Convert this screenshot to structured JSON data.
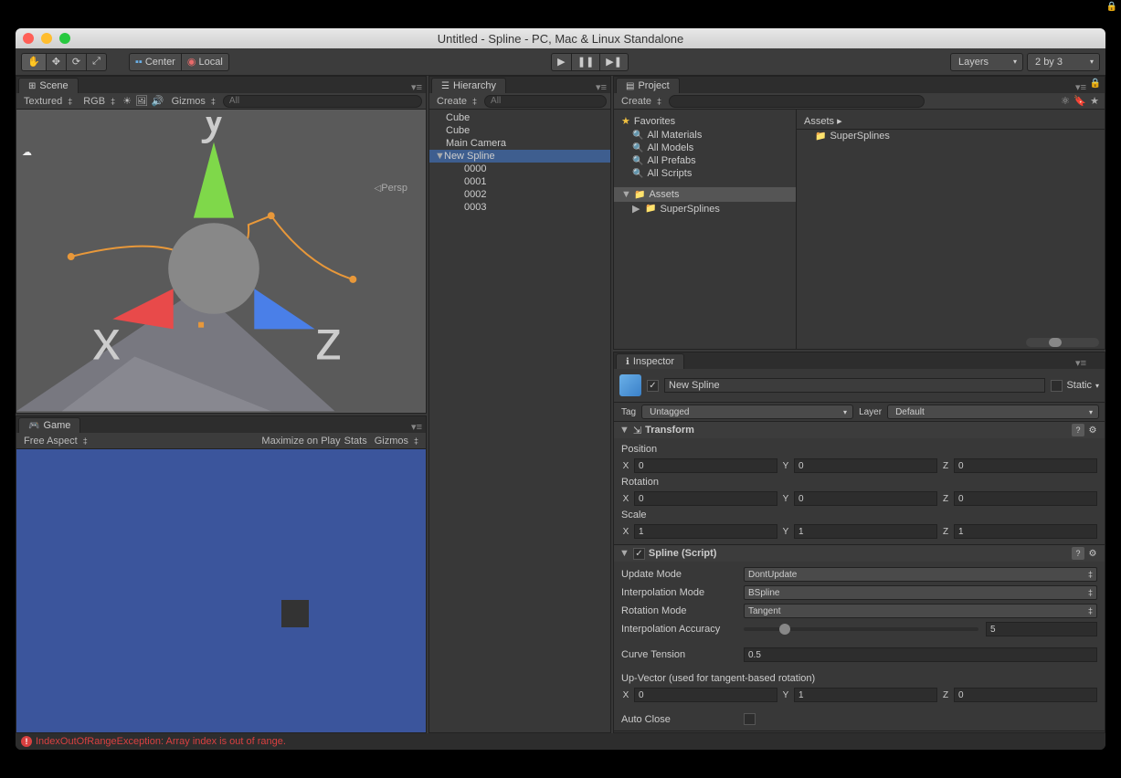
{
  "window": {
    "title": "Untitled - Spline - PC, Mac & Linux Standalone"
  },
  "toolbar": {
    "center": "Center",
    "local": "Local",
    "layers": "Layers",
    "layout": "2 by 3"
  },
  "scene": {
    "tab": "Scene",
    "shading": "Textured",
    "rgb": "RGB",
    "gizmos": "Gizmos",
    "search_placeholder": "All",
    "persp": "Persp",
    "axes": {
      "x": "x",
      "y": "y",
      "z": "z"
    }
  },
  "game": {
    "tab": "Game",
    "aspect": "Free Aspect",
    "maximize": "Maximize on Play",
    "stats": "Stats",
    "gizmos": "Gizmos"
  },
  "hierarchy": {
    "tab": "Hierarchy",
    "create": "Create",
    "search_placeholder": "All",
    "items": [
      "Cube",
      "Cube",
      "Main Camera",
      "New Spline",
      "0000",
      "0001",
      "0002",
      "0003"
    ]
  },
  "project": {
    "tab": "Project",
    "create": "Create",
    "favorites": "Favorites",
    "fav_items": [
      "All Materials",
      "All Models",
      "All Prefabs",
      "All Scripts"
    ],
    "assets": "Assets",
    "asset_items": [
      "SuperSplines"
    ],
    "breadcrumb": "Assets ▸",
    "right_items": [
      "SuperSplines"
    ]
  },
  "inspector": {
    "tab": "Inspector",
    "name": "New Spline",
    "static": "Static",
    "tag_label": "Tag",
    "tag_value": "Untagged",
    "layer_label": "Layer",
    "layer_value": "Default",
    "transform": {
      "title": "Transform",
      "position": "Position",
      "rotation": "Rotation",
      "scale": "Scale",
      "x": "X",
      "y": "Y",
      "z": "Z",
      "pos": {
        "x": "0",
        "y": "0",
        "z": "0"
      },
      "rot": {
        "x": "0",
        "y": "0",
        "z": "0"
      },
      "scl": {
        "x": "1",
        "y": "1",
        "z": "1"
      }
    },
    "spline": {
      "title": "Spline (Script)",
      "update_mode_label": "Update Mode",
      "update_mode": "DontUpdate",
      "interp_mode_label": "Interpolation Mode",
      "interp_mode": "BSpline",
      "rot_mode_label": "Rotation Mode",
      "rot_mode": "Tangent",
      "accuracy_label": "Interpolation Accuracy",
      "accuracy": "5",
      "tension_label": "Curve Tension",
      "tension": "0.5",
      "upvector_label": "Up-Vector (used for tangent-based rotation)",
      "up": {
        "x": "0",
        "y": "1",
        "z": "0"
      },
      "autoclose_label": "Auto Close"
    }
  },
  "statusbar": {
    "error": "IndexOutOfRangeException: Array index is out of range."
  }
}
